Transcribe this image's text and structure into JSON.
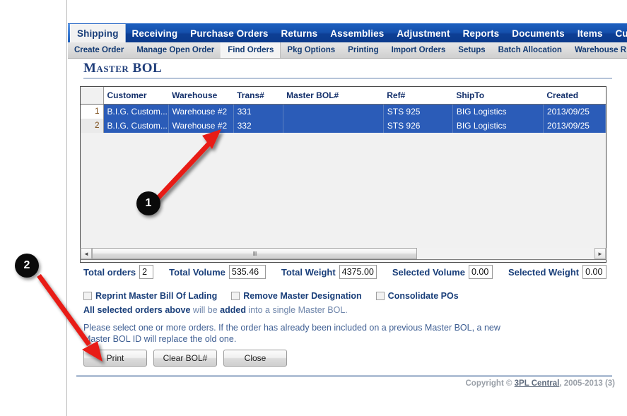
{
  "main_nav": {
    "items": [
      {
        "label": "Shipping",
        "active": true
      },
      {
        "label": "Receiving",
        "active": false
      },
      {
        "label": "Purchase Orders",
        "active": false
      },
      {
        "label": "Returns",
        "active": false
      },
      {
        "label": "Assemblies",
        "active": false
      },
      {
        "label": "Adjustment",
        "active": false
      },
      {
        "label": "Reports",
        "active": false
      },
      {
        "label": "Documents",
        "active": false
      },
      {
        "label": "Items",
        "active": false
      },
      {
        "label": "Customer",
        "active": false
      }
    ]
  },
  "sub_nav": {
    "items": [
      {
        "label": "Create Order",
        "active": false
      },
      {
        "label": "Manage Open Order",
        "active": false
      },
      {
        "label": "Find Orders",
        "active": true
      },
      {
        "label": "Pkg Options",
        "active": false
      },
      {
        "label": "Printing",
        "active": false
      },
      {
        "label": "Import Orders",
        "active": false
      },
      {
        "label": "Setups",
        "active": false
      },
      {
        "label": "Batch Allocation",
        "active": false
      },
      {
        "label": "Warehouse R",
        "active": false
      }
    ]
  },
  "page": {
    "title": "Master BOL"
  },
  "grid": {
    "columns": [
      "",
      "Customer",
      "Warehouse",
      "Trans#",
      "Master BOL#",
      "Ref#",
      "ShipTo",
      "Created"
    ],
    "rows": [
      {
        "num": "1",
        "customer": "B.I.G. Custom...",
        "warehouse": "Warehouse #2",
        "trans": "331",
        "master_bol": "",
        "ref": "STS 925",
        "shipto": "BIG Logistics",
        "created": "2013/09/25",
        "selected": true
      },
      {
        "num": "2",
        "customer": "B.I.G. Custom...",
        "warehouse": "Warehouse #2",
        "trans": "332",
        "master_bol": "",
        "ref": "STS 926",
        "shipto": "BIG Logistics",
        "created": "2013/09/25",
        "selected": true
      }
    ]
  },
  "scrollbar": {
    "left_arrow": "◄",
    "right_arrow": "►",
    "grip": "‖‖"
  },
  "totals": {
    "total_orders_label": "Total orders",
    "total_orders_value": "2",
    "total_volume_label": "Total Volume",
    "total_volume_value": "535.46",
    "total_weight_label": "Total Weight",
    "total_weight_value": "4375.00",
    "selected_volume_label": "Selected Volume",
    "selected_volume_value": "0.00",
    "selected_weight_label": "Selected Weight",
    "selected_weight_value": "0.00"
  },
  "checkboxes": [
    {
      "label": "Reprint Master Bill Of Lading",
      "checked": false
    },
    {
      "label": "Remove Master Designation",
      "checked": false
    },
    {
      "label": "Consolidate POs",
      "checked": false
    }
  ],
  "info": {
    "strong_1": "All selected orders above",
    "mid_1": " will be ",
    "strong_2": "added",
    "mid_2": " into a single Master BOL."
  },
  "note": {
    "line1": "Please select one or more orders. If the order has already been included on a previous Master BOL, a new",
    "line2": "Master BOL ID will replace the old one."
  },
  "buttons": [
    {
      "label": "Print"
    },
    {
      "label": "Clear BOL#"
    },
    {
      "label": "Close"
    }
  ],
  "footer": {
    "prefix": "Copyright © ",
    "link": "3PL Central",
    "suffix": ", 2005-2013 (3)"
  },
  "annotations": [
    {
      "number": "1"
    },
    {
      "number": "2"
    }
  ],
  "colors": {
    "nav_blue": "#0d3f95",
    "selection_blue": "#2b5cb8",
    "heading_blue": "#1f3d7a",
    "annotation_red": "#e81b16",
    "badge_black": "#0a0a0a"
  }
}
